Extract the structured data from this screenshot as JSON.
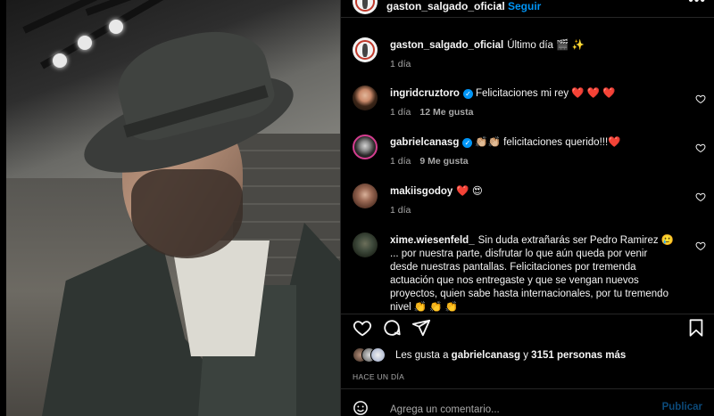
{
  "post": {
    "author": "gaston_salgado_oficial",
    "separator": "•",
    "follow_label": "Seguir",
    "more_label": "•••",
    "photo_subject": "man in fedora hat and dark coat, selfie"
  },
  "caption": {
    "user": "gaston_salgado_oficial",
    "text": "Último día 🎬 ✨",
    "time": "1 día"
  },
  "comments": [
    {
      "user": "ingridcruztoro",
      "verified": true,
      "text": "Felicitaciones mi rey ❤️ ❤️ ❤️",
      "time": "1 día",
      "likes": "12 Me gusta"
    },
    {
      "user": "gabrielcanasg",
      "verified": true,
      "text": "👏🏼👏🏼 felicitaciones querido!!!❤️",
      "time": "1 día",
      "likes": "9 Me gusta"
    },
    {
      "user": "makiisgodoy",
      "verified": false,
      "text": "❤️ 😍",
      "time": "1 día",
      "likes": ""
    },
    {
      "user": "xime.wiesenfeld_",
      "verified": false,
      "text": "Sin duda extrañarás ser Pedro Ramirez 🥲 ... por nuestra parte, disfrutar lo que aún queda por venir desde nuestras pantallas. Felicitaciones por tremenda actuación que nos entregaste y que se vengan nuevos proyectos, quien sabe hasta internacionales, por tu tremendo nivel 👏 👏 👏",
      "time": "",
      "likes": ""
    }
  ],
  "likes": {
    "prefix": "Les gusta a",
    "user": "gabrielcanasg",
    "middle": "y",
    "rest": "3151 personas más"
  },
  "posted": "HACE UN DÍA",
  "composer": {
    "placeholder": "Agrega un comentario...",
    "publish": "Publicar"
  },
  "icons": {
    "like": "heart-outline-icon",
    "comment": "comment-bubble-icon",
    "share": "paper-plane-icon",
    "save": "bookmark-icon",
    "emoji": "smiley-icon"
  },
  "colors": {
    "background": "#000000",
    "text": "#f5f5f5",
    "muted": "#a8a8a8",
    "link": "#0095f6",
    "divider": "#262626"
  }
}
